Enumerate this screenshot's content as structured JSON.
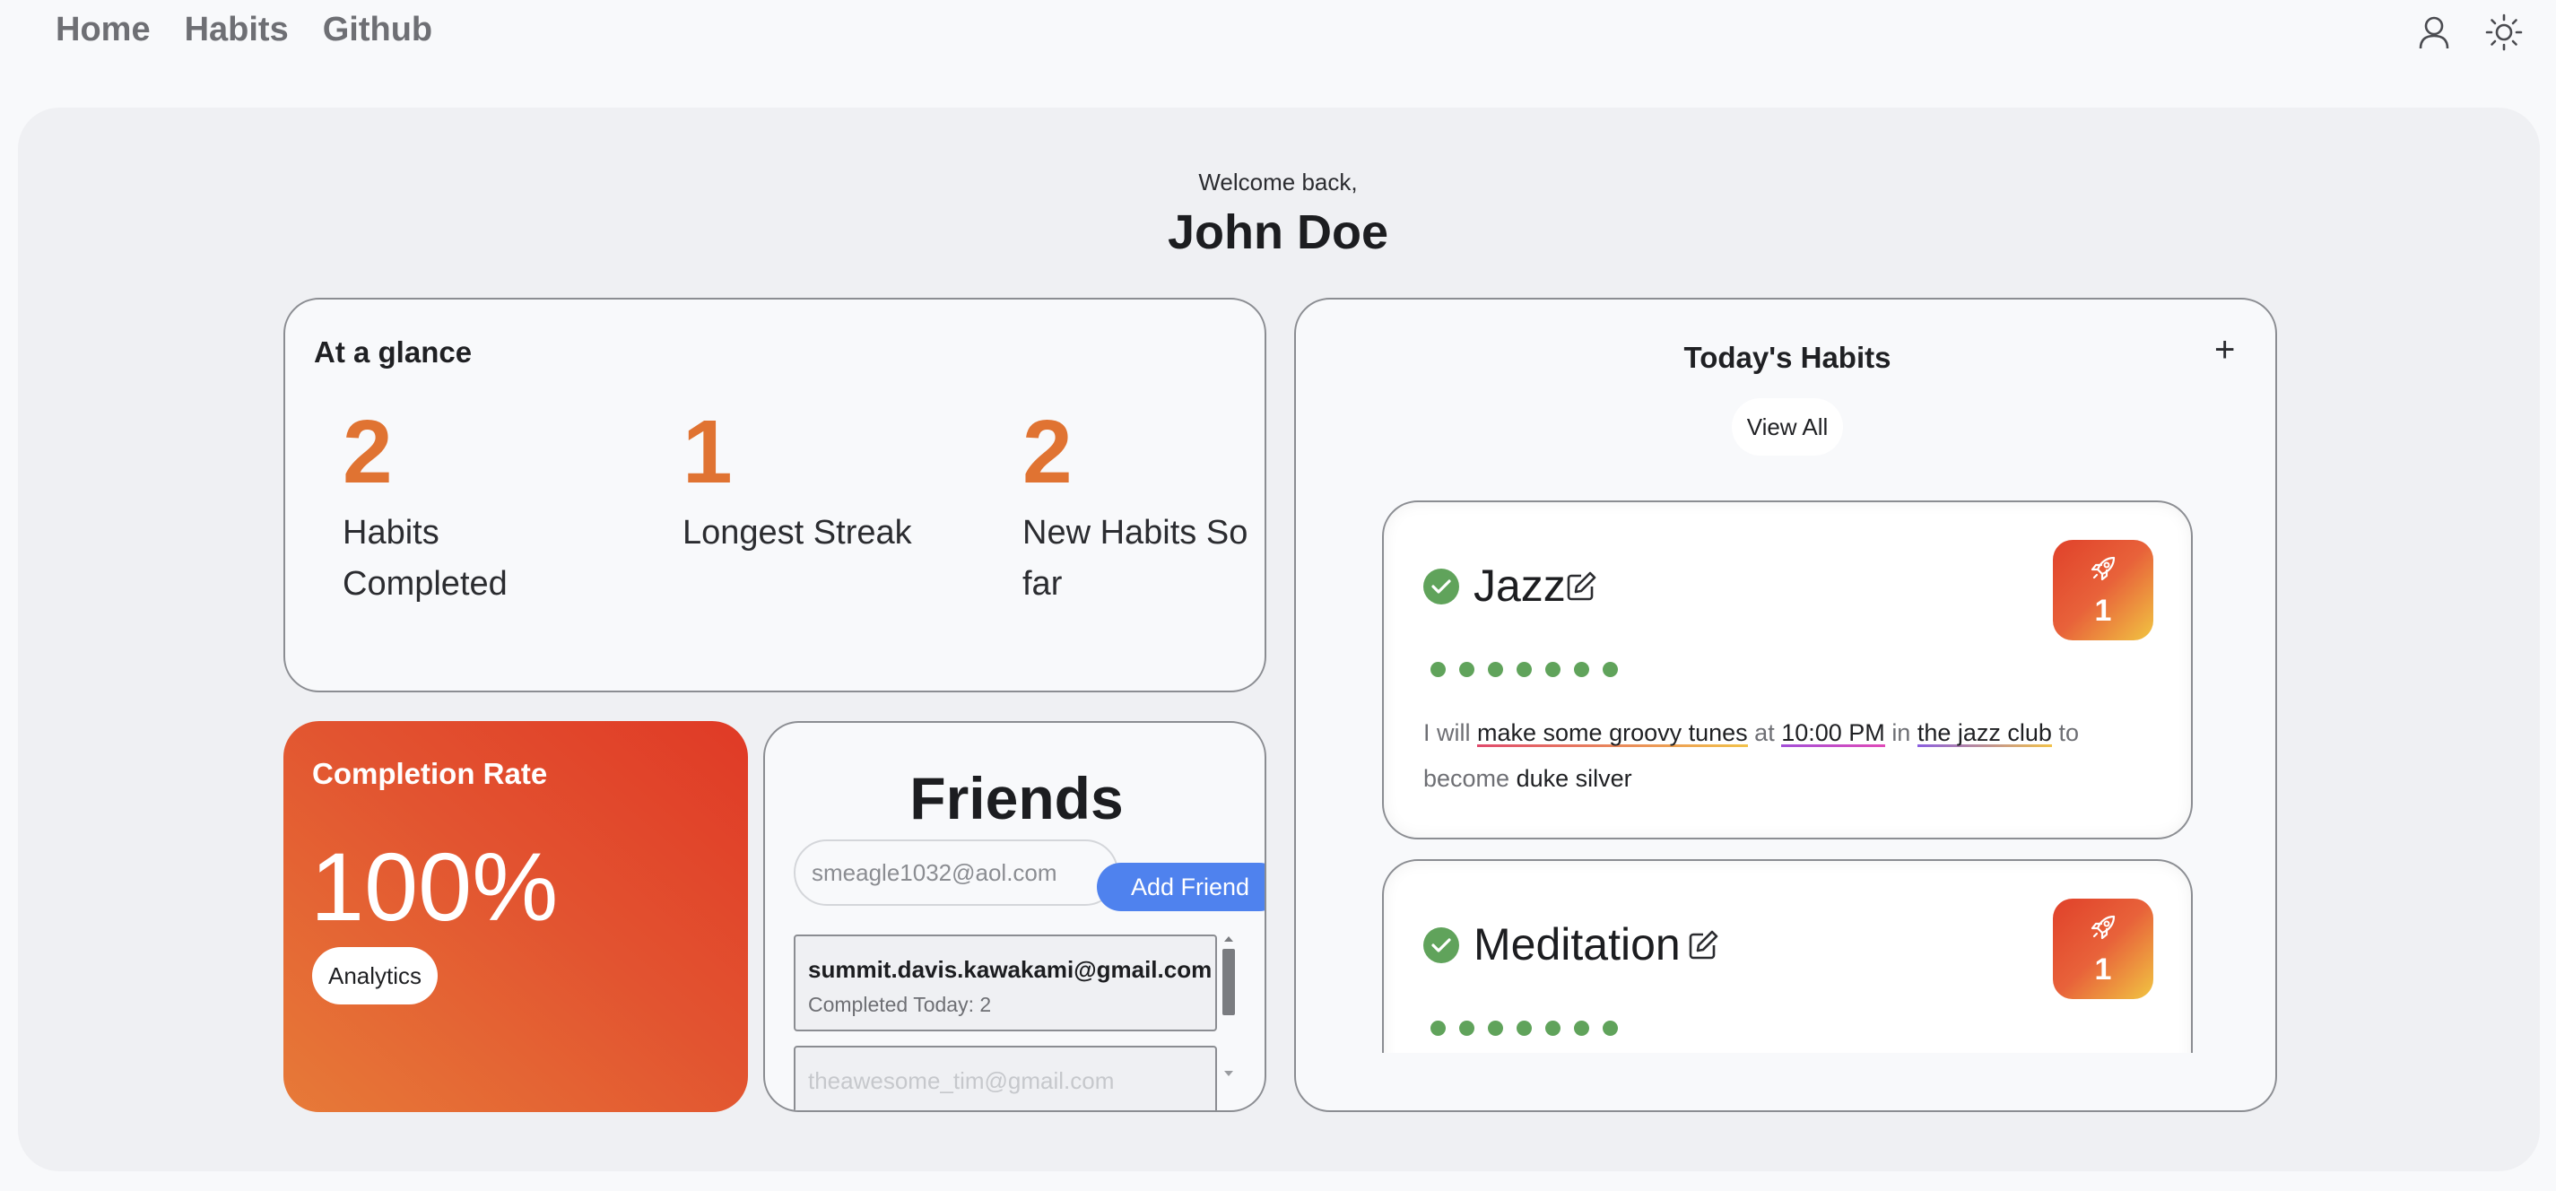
{
  "nav": {
    "links": [
      "Home",
      "Habits",
      "Github"
    ],
    "icons": [
      "user-icon",
      "sun-icon"
    ]
  },
  "welcome": {
    "greeting": "Welcome back,",
    "name": "John Doe"
  },
  "glance": {
    "title": "At a glance",
    "stats": [
      {
        "value": "2",
        "label": "Habits Completed"
      },
      {
        "value": "1",
        "label": "Longest Streak"
      },
      {
        "value": "2",
        "label": "New Habits So far"
      }
    ]
  },
  "completion": {
    "title": "Completion Rate",
    "value": "100%",
    "analytics_label": "Analytics"
  },
  "friends": {
    "title": "Friends",
    "input_placeholder": "smeagle1032@aol.com",
    "add_label": "Add Friend",
    "items": [
      {
        "email": "summit.davis.kawakami@gmail.com",
        "status": "Completed Today: 2"
      },
      {
        "email": "theawesome_tim@gmail.com",
        "status": ""
      }
    ]
  },
  "habits": {
    "title": "Today's Habits",
    "add_icon": "plus-icon",
    "view_all_label": "View All",
    "items": [
      {
        "name": "Jazz",
        "streak": "1",
        "dots": 7,
        "sentence": {
          "p1": "I will",
          "action": "make some groovy tunes",
          "p2": "at",
          "time": "10:00 PM",
          "p3": "in",
          "place": "the jazz club",
          "p4": "to become",
          "identity": "duke silver"
        }
      },
      {
        "name": "Meditation",
        "streak": "1",
        "dots": 7
      }
    ]
  },
  "colors": {
    "accent_orange": "#e07332",
    "completion_gradient": [
      "#e03a26",
      "#e77a38"
    ],
    "add_friend_blue": "#4f82ee",
    "check_green": "#60a35b"
  }
}
